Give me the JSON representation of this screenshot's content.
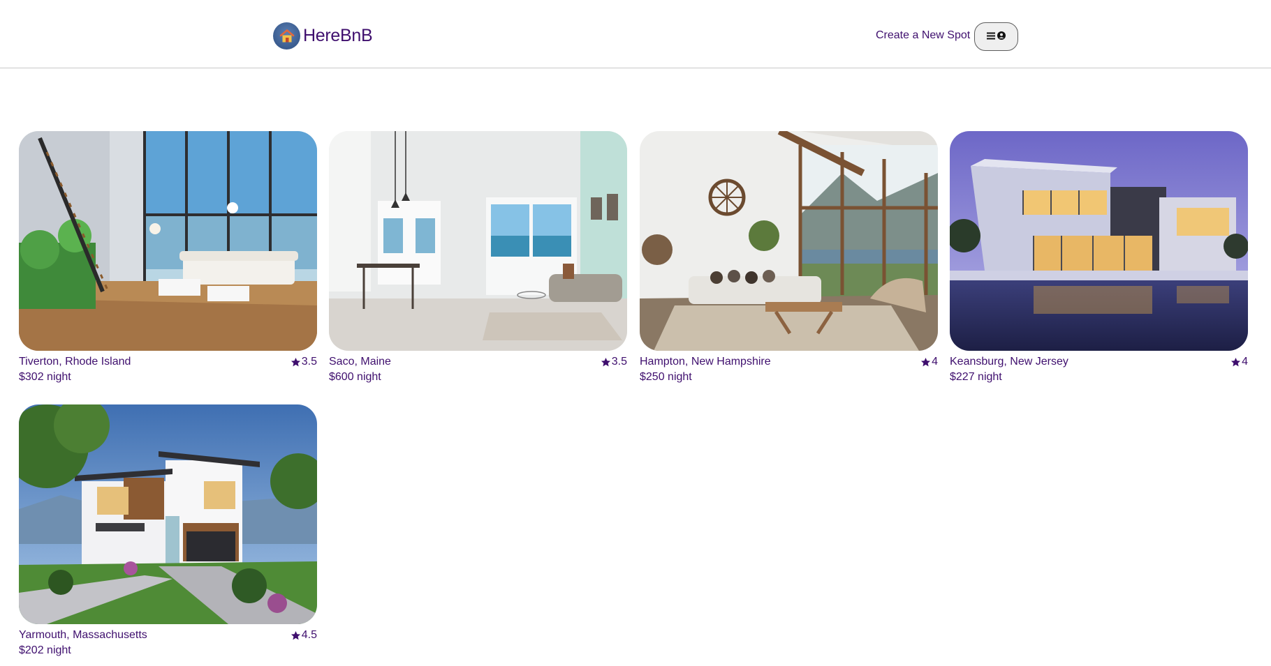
{
  "header": {
    "brand_name": "HereBnB",
    "logo_icon": "house-icon",
    "create_spot_label": "Create a New Spot",
    "menu_icons": [
      "menu-icon",
      "user-icon"
    ]
  },
  "spots": [
    {
      "location": "Tiverton, Rhode Island",
      "rating": "3.5",
      "price": "$302 night",
      "scene": "interior-loft"
    },
    {
      "location": "Saco, Maine",
      "rating": "3.5",
      "price": "$600 night",
      "scene": "interior-dining-sea"
    },
    {
      "location": "Hampton, New Hampshire",
      "rating": "4",
      "price": "$250 night",
      "scene": "interior-lodge-lake"
    },
    {
      "location": "Keansburg, New Jersey",
      "rating": "4",
      "price": "$227 night",
      "scene": "exterior-dusk-pool"
    },
    {
      "location": "Yarmouth, Massachusetts",
      "rating": "4.5",
      "price": "$202 night",
      "scene": "exterior-modern-day"
    }
  ],
  "colors": {
    "brand": "#3f0f6e",
    "header_border": "#c8c8c8",
    "menu_button_bg": "#efefef",
    "logo_badge": "#3a5c8f"
  }
}
